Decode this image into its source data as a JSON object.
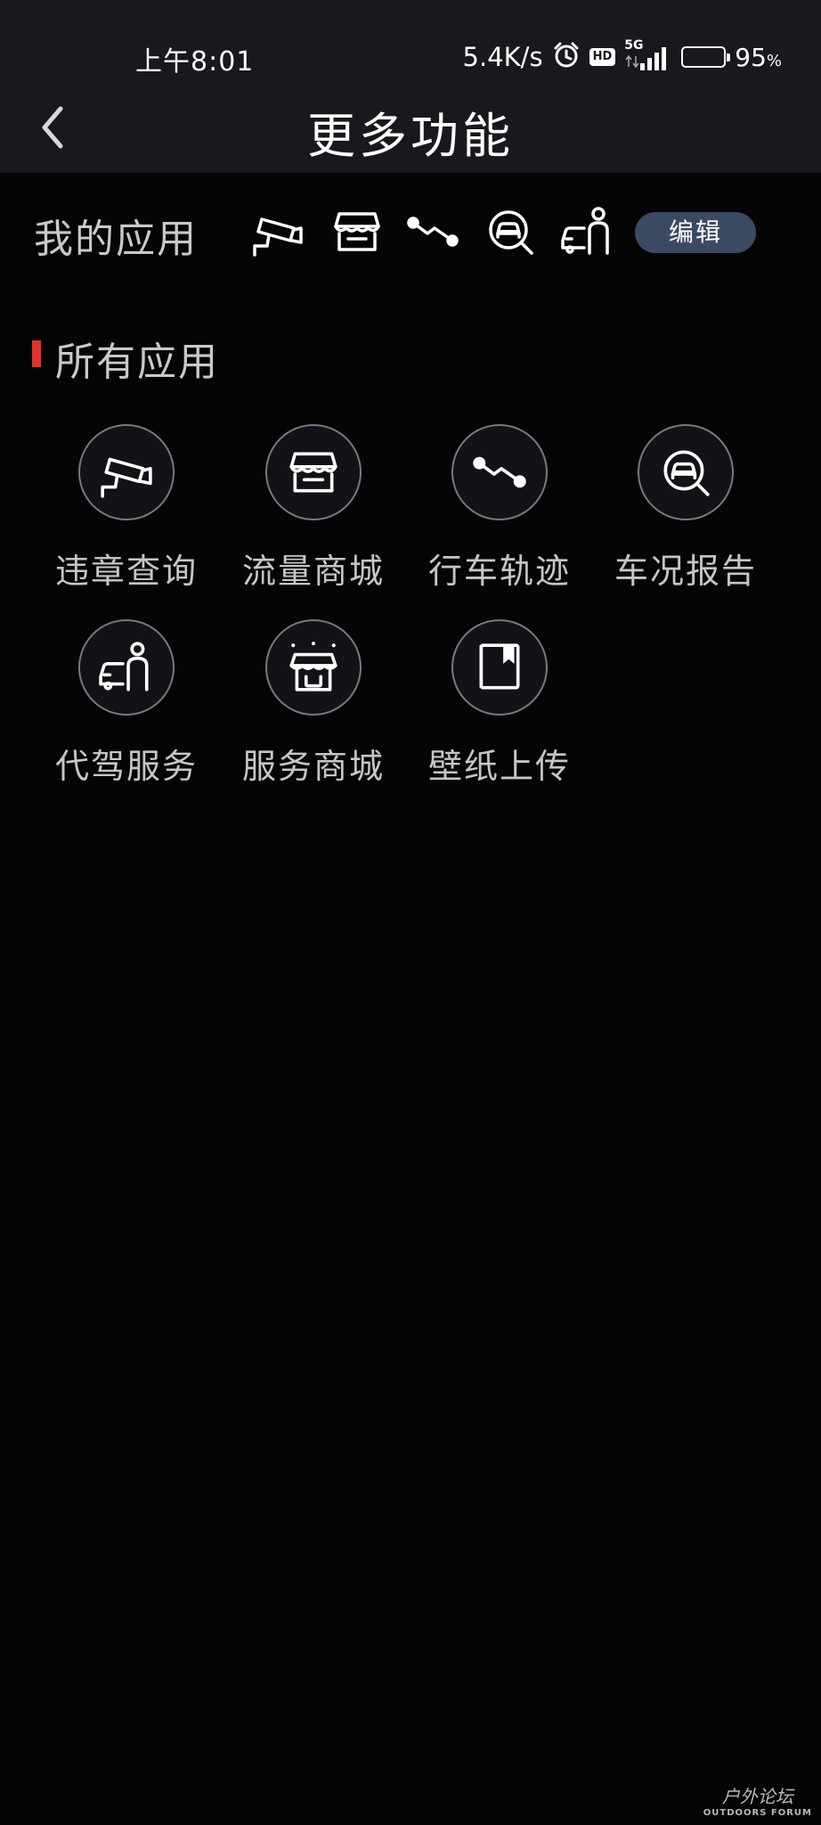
{
  "status_bar": {
    "time": "上午8:01",
    "net_speed": "5.4K/s",
    "hd_badge": "HD",
    "network_type": "5G",
    "battery_percent": "95",
    "battery_unit": "%",
    "battery_color": "#54c54a"
  },
  "header": {
    "title": "更多功能",
    "back_icon": "chevron-left-icon"
  },
  "my_apps": {
    "label": "我的应用",
    "icons": [
      "camera-icon",
      "shop-icon",
      "route-icon",
      "car-search-icon",
      "chauffeur-icon"
    ],
    "edit_label": "编辑",
    "edit_color": "#3b4a63"
  },
  "all_apps": {
    "title": "所有应用",
    "accent_color": "#e3322b",
    "items": [
      {
        "label": "违章查询",
        "icon": "camera-icon"
      },
      {
        "label": "流量商城",
        "icon": "shop-icon"
      },
      {
        "label": "行车轨迹",
        "icon": "route-icon"
      },
      {
        "label": "车况报告",
        "icon": "car-search-icon"
      },
      {
        "label": "代驾服务",
        "icon": "chauffeur-icon"
      },
      {
        "label": "服务商城",
        "icon": "store-icon"
      },
      {
        "label": "壁纸上传",
        "icon": "bookmark-icon"
      }
    ]
  },
  "watermark": {
    "cn": "户外论坛",
    "en": "OUTDOORS FORUM"
  }
}
